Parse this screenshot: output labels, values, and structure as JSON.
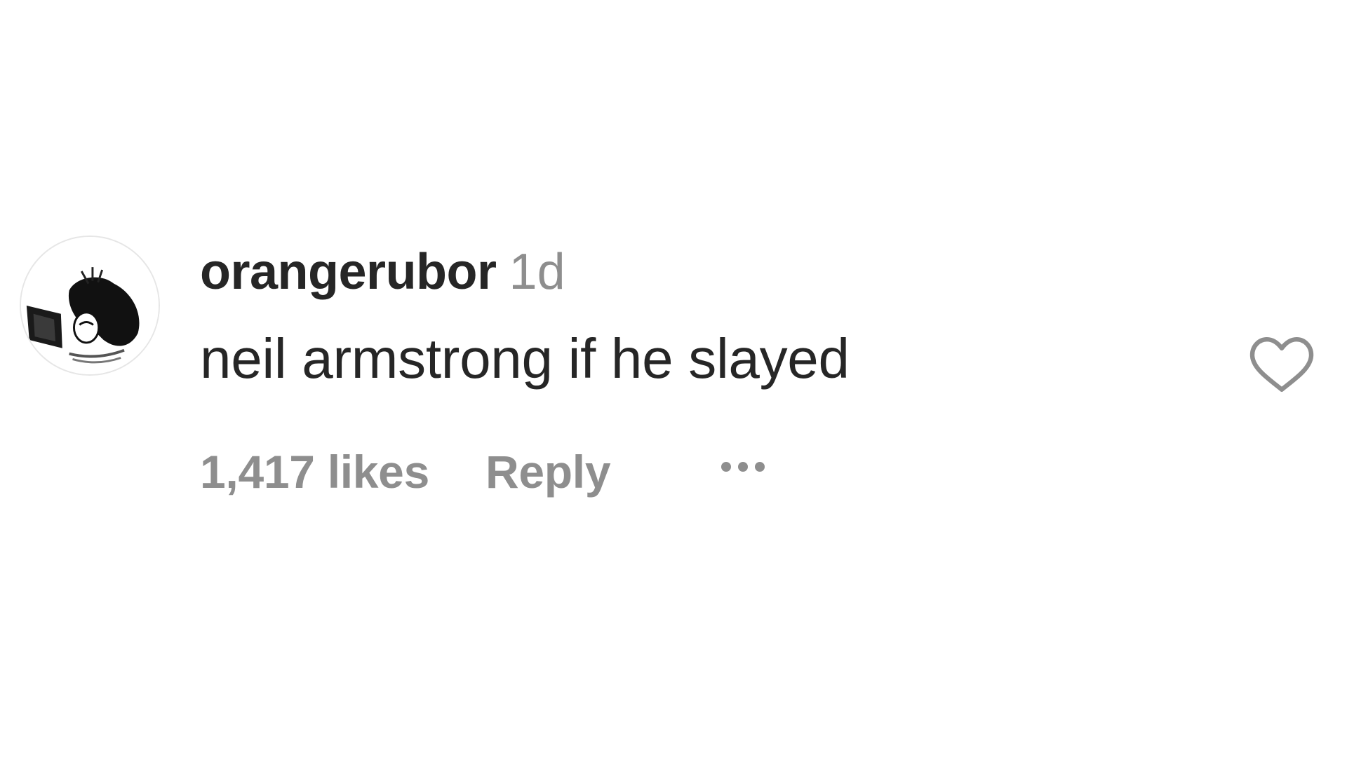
{
  "comment": {
    "username": "orangerubor",
    "time_ago": "1d",
    "text": "neil armstrong if he slayed",
    "likes_label": "1,417 likes",
    "reply_label": "Reply",
    "more_icon": "more-horizontal-icon",
    "like_icon": "heart-outline-icon",
    "avatar_icon": "avatar-image"
  },
  "colors": {
    "primary_text": "#262626",
    "secondary_text": "#8e8e8e",
    "background": "#ffffff"
  }
}
